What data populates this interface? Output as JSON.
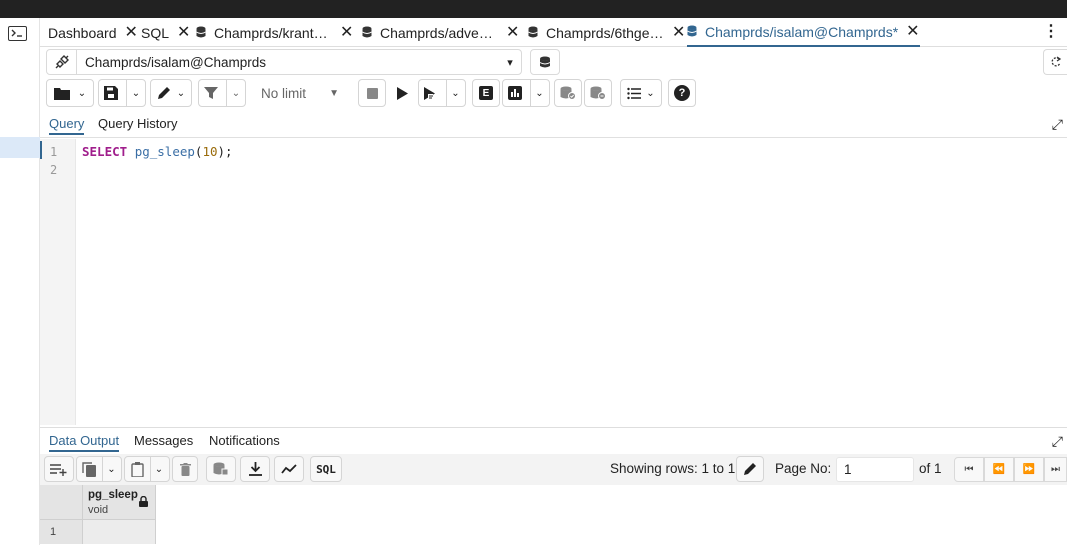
{
  "tabs": [
    {
      "label": "Dashboard",
      "type": "plain"
    },
    {
      "label": "SQL",
      "type": "plain"
    },
    {
      "label": "Champrds/kranthi...",
      "type": "db"
    },
    {
      "label": "Champrds/advent...",
      "type": "db"
    },
    {
      "label": "Champrds/6thgen...",
      "type": "db"
    },
    {
      "label": "Champrds/isalam@Champrds*",
      "type": "db",
      "active": true
    }
  ],
  "connection": {
    "name": "Champrds/isalam@Champrds"
  },
  "toolbar": {
    "row_limit": "No limit"
  },
  "query_tabs": {
    "query": "Query",
    "history": "Query History"
  },
  "editor": {
    "line_numbers": [
      "1",
      "2"
    ],
    "line1": {
      "keyword": "SELECT",
      "function": "pg_sleep",
      "open": "(",
      "arg": "10",
      "close": ");"
    }
  },
  "output_tabs": {
    "data": "Data Output",
    "messages": "Messages",
    "notifications": "Notifications"
  },
  "output_toolbar": {
    "sql_label": "SQL",
    "showing": "Showing rows: 1 to 1",
    "page_label": "Page No:",
    "page_value": "1",
    "of_label": "of 1"
  },
  "grid": {
    "column_name": "pg_sleep",
    "column_type": "void",
    "row_number": "1"
  },
  "colors": {
    "accent": "#326690",
    "keyword": "#a01e8c",
    "function": "#3a6ea5",
    "number": "#9a6b0a"
  }
}
